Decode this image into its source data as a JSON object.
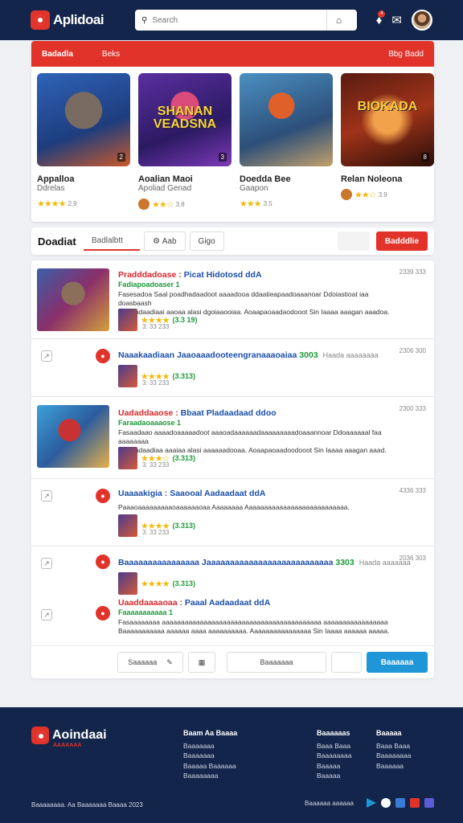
{
  "header": {
    "logo_text": "Aplidoai",
    "search_placeholder": "Search",
    "notif_count": "4"
  },
  "promo_bar": {
    "left": "Badadla",
    "mid": "Beks",
    "right": "Bbg Badd"
  },
  "games": [
    {
      "title": "Appalloa",
      "sub": "Ddrelas",
      "rating_num": "2.9",
      "badge": "2"
    },
    {
      "title": "Aoalian Maoi",
      "sub": "Apoliad Genad",
      "rating_num": "3.8",
      "badge": "3",
      "art": "SHANAN VEADSNA"
    },
    {
      "title": "Doedda Bee",
      "sub": "Gaapon",
      "rating_num": "3.5",
      "badge": ""
    },
    {
      "title": "Relan Noleona",
      "sub": "",
      "rating_num": "3.9",
      "badge": "8",
      "art": "BIOKADA"
    }
  ],
  "tabs": {
    "title": "Doadiat",
    "items": [
      "Badlalbtt",
      "Aab",
      "Gigo"
    ],
    "cta": "Badddlie"
  },
  "list": [
    {
      "title_red": "Pradddadoase :",
      "title_blue": "Picat Hidotosd ddA",
      "sub": "Fadiapoadoaser 1",
      "desc1": "Fasesadoa Saal poadhadaadoot aaaadooa ddaatieapaadoaaanoar Ddoiastioat iaa doasbaash",
      "desc2": "Gadoadaadiaai aaoaa alasi dgoiaaooiaa. Aoaapaoaadaodooot Sin Iaaaa aaagan aaadoa.",
      "time": "2339 333",
      "price": "(3.3 19)",
      "date": "3: 33 233"
    },
    {
      "title_blue": "Naaakaadiaan Jaaoaaadooteengranaaaoaiaa",
      "title_green": "3003",
      "extra": "Haada aaaaaaaa",
      "time": "2306 300",
      "price": "(3.313)",
      "date": "3: 33 233"
    },
    {
      "title_red": "Uadaddaaose :",
      "title_blue": "Bbaat Pladaadaad ddoo",
      "sub": "Faraadaoaaaose 1",
      "desc1": "Fasaadaao aaaadoaaaaadoot aaaoadaaaaaadaaaaaaaaadoaaannoar Ddoaaaaaal faa aaaaaaaa",
      "desc2": "Gadoadaadiaa aaaiaa alasi aaaaaadooaa. Aoaapaoaadoodooot Sin Iaaaa aaagan aaad.",
      "time": "2300 333",
      "price": "(3.313)",
      "date": "3: 33 233"
    },
    {
      "title_blue": "Uaaaakigia :",
      "title_tail": "Saaooal Aadaadaat ddA",
      "desc1": "Paaaoaaaaaaaaaoaaaaaaoaa Aaaaaaaa Aaaaaaaaaaaaaaaaaaaaaaaaaaa.",
      "time": "4336 333",
      "price": "(3.313)",
      "date": "3: 33 233"
    },
    {
      "title_blue": "Baaaaaaaaaaaaaaaa Jaaaaaaaaaaaaaaaaaaaaaaaaaaa",
      "title_green": "3303",
      "extra": "Haada aaaaaaa",
      "time": "2036 303",
      "price": "(3.313)",
      "date": ""
    },
    {
      "title_red": "Uaaddaaaaoaa :",
      "title_blue": "Paaal Aadaadaat ddA",
      "sub": "Faaaaaaaaaaa 1",
      "desc1": "Fasaaaaaaaa aaaaaaaaaaaaaaaaaaaaaaaaaaaaaaaaaaaaaaaaaa aaaaaaaaaaaaaaaaa",
      "desc2": "Baaaaaaaaaaa aaaaaa aaaa aaaaaaaaaa. Aaaaaaaaaaaaaaaa Sin Iaaaa aaaaaa aaaaa.",
      "time": "",
      "price": "",
      "date": ""
    }
  ],
  "list_footer": {
    "search_label": "Saaaaaa",
    "mid_label": "Baaaaaaa",
    "primary": "Baaaaaa"
  },
  "footer": {
    "logo_text": "Aoindaai",
    "tagline": "AAAAAAA",
    "col1_head": "Baam Aa Baaaa",
    "col1": [
      "Baaaaaaa",
      "Baaaaaaa",
      "Baaaaa Baaaaaa",
      "Baaaaaaaa"
    ],
    "col2_head": "Baaaaaas",
    "col2": [
      "Baaa Baaa",
      "Baaaaaaaa",
      "Baaaaa",
      "Baaaaa"
    ],
    "col3_head": "Baaaaa",
    "col3": [
      "Baaa Baaa",
      "Baaaaaaaa",
      "Baaaaaa"
    ],
    "copyright": "Baaaaaaaa. Aa Baaaaaaa Baaaa 2023",
    "follow": "Baaaaaa aaaaaa"
  },
  "colors": {
    "primary": "#e2332b",
    "navy": "#13254a",
    "blue": "#1f96d8",
    "green": "#1d9a3a"
  }
}
